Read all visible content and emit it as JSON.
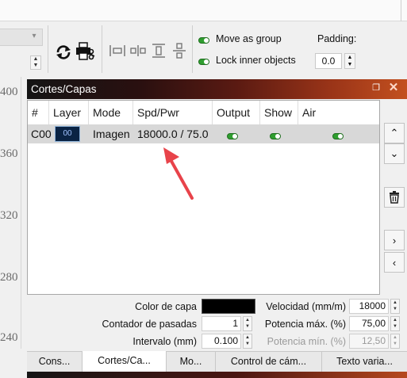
{
  "ruler": {
    "labels": [
      "400",
      "360",
      "320",
      "280",
      "240"
    ]
  },
  "toolbar": {
    "move_as_group": "Move as group",
    "lock_inner_objects": "Lock inner objects",
    "padding_label": "Padding:",
    "padding_value": "0.0",
    "toggle_color": "#2f9e2f"
  },
  "panel": {
    "title": "Cortes/Capas",
    "columns": [
      "#",
      "Layer",
      "Mode",
      "Spd/Pwr",
      "Output",
      "Show",
      "Air"
    ],
    "rows": [
      {
        "index": "C00",
        "layer": "00",
        "mode": "Imagen",
        "spd_pwr": "18000.0 / 75.0",
        "output": true,
        "show": true,
        "air": true
      }
    ],
    "layer_swatch_color": "#0a2344"
  },
  "properties": {
    "color_label": "Color de capa",
    "color_value": "#000000",
    "passes_label": "Contador de pasadas",
    "passes_value": "1",
    "interval_label": "Intervalo (mm)",
    "interval_value": "0.100",
    "speed_label": "Velocidad (mm/m)",
    "speed_value": "18000",
    "max_power_label": "Potencia máx. (%)",
    "max_power_value": "75,00",
    "min_power_label": "Potencia mín. (%)",
    "min_power_value": "12,50"
  },
  "tabs": [
    "Cons...",
    "Cortes/Ca...",
    "Mo...",
    "Control de cám...",
    "Texto varia..."
  ],
  "active_tab": "Cortes/Ca...",
  "annotation": {
    "arrow_color": "#e8434a"
  }
}
